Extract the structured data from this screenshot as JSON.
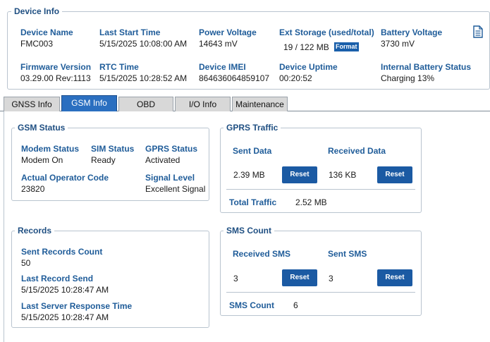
{
  "device_info": {
    "title": "Device Info",
    "model_label": "Device Name",
    "model_value": "FMC003",
    "last_start_label": "Last Start Time",
    "last_start_value": "5/15/2025 10:08:00 AM",
    "power_voltage_label": "Power Voltage",
    "power_voltage_value": "14643 mV",
    "ext_storage_label": "Ext Storage (used/total)",
    "ext_storage_value": "19 / 122 MB",
    "format_label": "Format",
    "battery_voltage_label": "Battery Voltage",
    "battery_voltage_value": "3730 mV",
    "firmware_label": "Firmware Version",
    "firmware_value": "03.29.00 Rev:1113",
    "rtc_label": "RTC Time",
    "rtc_value": "5/15/2025 10:28:52 AM",
    "imei_label": "Device IMEI",
    "imei_value": "864636064859107",
    "uptime_label": "Device Uptime",
    "uptime_value": "00:20:52",
    "battery_status_label": "Internal Battery Status",
    "battery_status_value": "Charging 13%",
    "icon": "document-icon"
  },
  "tabs": [
    {
      "label": "GNSS Info",
      "active": false
    },
    {
      "label": "GSM Info",
      "active": true
    },
    {
      "label": "OBD",
      "active": false
    },
    {
      "label": "I/O Info",
      "active": false
    },
    {
      "label": "Maintenance",
      "active": false
    }
  ],
  "gsm_status": {
    "title": "GSM Status",
    "modem_status_label": "Modem Status",
    "modem_status_value": "Modem On",
    "sim_status_label": "SIM Status",
    "sim_status_value": "Ready",
    "gprs_status_label": "GPRS Status",
    "gprs_status_value": "Activated",
    "operator_label": "Actual Operator Code",
    "operator_value": "23820",
    "signal_label": "Signal Level",
    "signal_value": "Excellent Signal"
  },
  "gprs_traffic": {
    "title": "GPRS Traffic",
    "sent_label": "Sent Data",
    "sent_value": "2.39 MB",
    "received_label": "Received Data",
    "received_value": "136 KB",
    "reset_label": "Reset",
    "total_label": "Total Traffic",
    "total_value": "2.52 MB"
  },
  "records": {
    "title": "Records",
    "sent_count_label": "Sent Records Count",
    "sent_count_value": "50",
    "last_send_label": "Last Record Send",
    "last_send_value": "5/15/2025 10:28:47 AM",
    "last_response_label": "Last Server Response Time",
    "last_response_value": "5/15/2025 10:28:47 AM"
  },
  "sms_count": {
    "title": "SMS Count",
    "received_label": "Received SMS",
    "received_value": "3",
    "sent_label": "Sent SMS",
    "sent_value": "3",
    "reset_label": "Reset",
    "total_label": "SMS Count",
    "total_value": "6"
  }
}
